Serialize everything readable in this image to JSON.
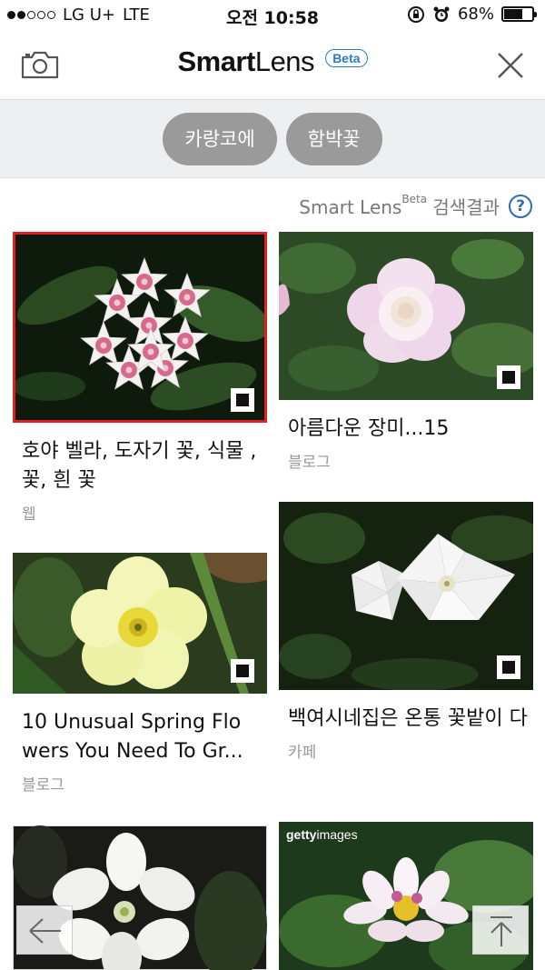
{
  "status_bar": {
    "carrier": "LG U+",
    "network": "LTE",
    "time": "오전 10:58",
    "battery": "68%",
    "battery_level": 0.68
  },
  "header": {
    "logo_bold": "Smart",
    "logo_light": "Lens",
    "badge": "Beta"
  },
  "keywords": [
    "카랑코에",
    "함박꽃"
  ],
  "result_header": {
    "label_prefix": "Smart Lens",
    "label_sup": "Beta",
    "label_suffix": " 검색결과",
    "help": "?"
  },
  "results": [
    {
      "caption": "호야 벨라, 도자기 꽃, 식물 , 꽃, 흰 꽃",
      "source": "웹",
      "selected": true
    },
    {
      "caption": "아름다운 장미...15",
      "source": "블로그",
      "selected": false
    },
    {
      "caption": "10 Unusual Spring Flo wers You Need To Gr...",
      "source": "블로그",
      "selected": false
    },
    {
      "caption": "백여시네집은 온통 꽃밭이 다",
      "source": "카페",
      "selected": false
    },
    {
      "caption": "",
      "source": "",
      "selected": false
    },
    {
      "caption": "",
      "source": "",
      "watermark_bold": "getty",
      "watermark_light": "images",
      "selected": false
    }
  ],
  "icons": {
    "camera": "camera-icon",
    "close": "close-icon",
    "help": "help-icon",
    "expand": "expand-icon",
    "back": "arrow-left-icon",
    "top": "arrow-up-icon"
  },
  "colors": {
    "accent": "#2a7ac0",
    "selection": "#e02020",
    "chip": "#9a9a9a"
  }
}
